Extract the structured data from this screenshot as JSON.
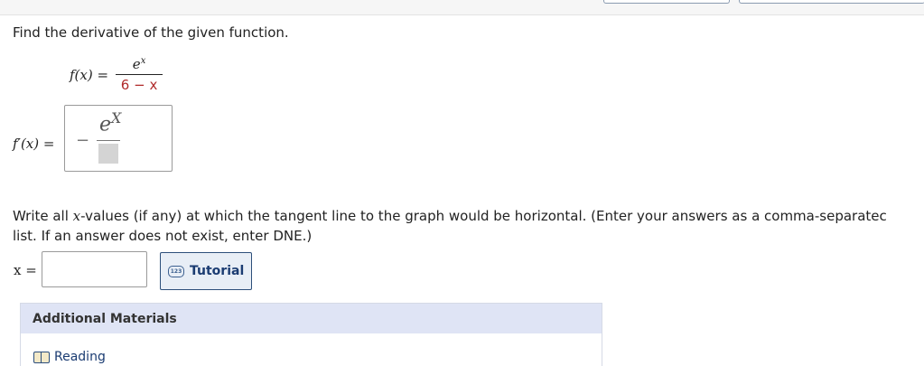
{
  "question": {
    "prompt": "Find the derivative of the given function.",
    "function": {
      "lhs": "f(x) =",
      "numerator_base": "e",
      "numerator_exp": "x",
      "denominator": "6 − x"
    },
    "derivative_label": "f′(x) =",
    "derivative_answer": {
      "sign": "−",
      "numerator_base": "e",
      "numerator_exp": "X"
    },
    "part2": {
      "text_before": "Write all ",
      "text_var": "x",
      "text_line1_rest": "-values (if any) at which the tangent line to the graph would be horizontal. (Enter your answers as a comma-separatec",
      "text_line2": "list. If an answer does not exist, enter DNE.)",
      "x_label": "x =",
      "x_value": ""
    },
    "tutorial": {
      "icon_text": "123",
      "label": "Tutorial"
    }
  },
  "additional_materials": {
    "title": "Additional Materials",
    "items": [
      {
        "label": "Reading",
        "icon": "book-icon"
      }
    ]
  }
}
